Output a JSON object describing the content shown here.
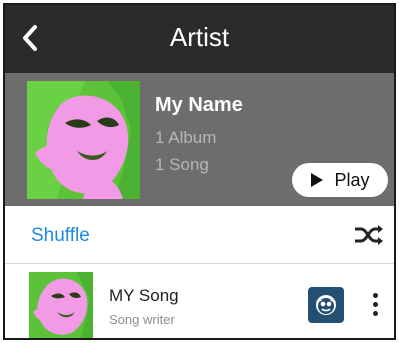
{
  "header": {
    "title": "Artist",
    "back_icon": "chevron-left-icon"
  },
  "artist": {
    "name": "My Name",
    "albums": "1 Album",
    "songs": "1 Song",
    "play_label": "Play",
    "play_icon": "play-icon"
  },
  "shuffle": {
    "label": "Shuffle",
    "icon": "shuffle-icon"
  },
  "song": {
    "title": "MY Song",
    "subtitle": "Song writer",
    "service_icon": "napster-icon",
    "more_icon": "more-vertical-icon"
  },
  "colors": {
    "header_bg": "#2b2b2b",
    "panel_bg": "#6d6d6d",
    "accent": "#1e88e5",
    "art_green": "#5cc23a",
    "art_pink": "#f29ae6"
  }
}
